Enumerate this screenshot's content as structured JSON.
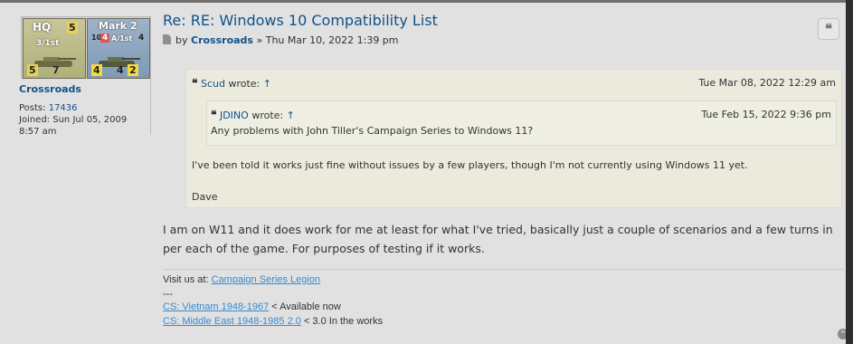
{
  "profile": {
    "avatar_counters": [
      {
        "top_left": "HQ",
        "top_right": "5",
        "name": "3/1st",
        "bottom_left": "5",
        "bottom_right": "7"
      },
      {
        "top_left": "Mark 2",
        "top_mid": "10",
        "top_mid2": "4",
        "top_right": "4",
        "name": "A/1st",
        "bottom_left": "4",
        "bottom_mid": "4",
        "bottom_right": "2"
      }
    ],
    "username": "Crossroads",
    "posts_label": "Posts:",
    "posts_value": "17436",
    "joined_label": "Joined:",
    "joined_value": "Sun Jul 05, 2009 8:57 am"
  },
  "post": {
    "title": "Re: RE: Windows 10 Compatibility List",
    "by_label": "by",
    "author": "Crossroads",
    "separator": "»",
    "date": "Thu Mar 10, 2022 1:39 pm",
    "quote_button_icon": "quote-icon",
    "outer_quote": {
      "mark": "❝",
      "author": "Scud",
      "wrote": "wrote:",
      "arrow": "↑",
      "date": "Tue Mar 08, 2022 12:29 am",
      "lines": [
        "I've been told it works just fine without issues by a few players, though I'm not currently using Windows 11 yet.",
        "Dave"
      ]
    },
    "inner_quote": {
      "mark": "❝",
      "author": "JDINO",
      "wrote": "wrote:",
      "arrow": "↑",
      "date": "Tue Feb 15, 2022 9:36 pm",
      "text": "Any problems with John Tiller's Campaign Series to Windows 11?"
    },
    "content": "I am on W11 and it does work for me at least for what I've tried, basically just a couple of scenarios and a few turns in per each of the game. For purposes of testing if it works.",
    "signature": {
      "visit_label": "Visit us at:",
      "visit_link": "Campaign Series Legion",
      "dashes": "---",
      "line1_link": "CS: Vietnam 1948-1967",
      "line1_text": "< Available now",
      "line2_link": "CS: Middle East 1948-1985 2.0",
      "line2_text": "< 3.0 In the works"
    },
    "top_icon": "^"
  }
}
